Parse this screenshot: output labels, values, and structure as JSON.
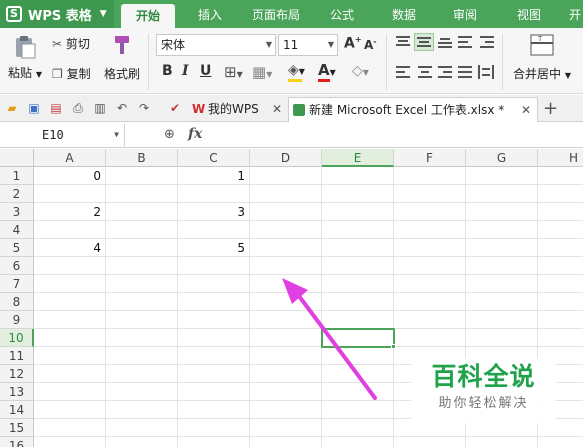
{
  "app": {
    "label": "WPS 表格",
    "logo": "S"
  },
  "menu": {
    "tabs": [
      {
        "label": "开始",
        "active": true
      },
      {
        "label": "插入"
      },
      {
        "label": "页面布局"
      },
      {
        "label": "公式"
      },
      {
        "label": "数据"
      },
      {
        "label": "审阅"
      },
      {
        "label": "视图"
      },
      {
        "label": "开"
      }
    ]
  },
  "ribbon": {
    "paste_label": "粘贴",
    "cut_label": "剪切",
    "copy_label": "复制",
    "format_painter_label": "格式刷",
    "font_name": "宋体",
    "font_size": "11",
    "bold": "B",
    "italic": "I",
    "underline": "U",
    "merge_label": "合并居中"
  },
  "tabs": {
    "my_wps": "我的WPS",
    "doc": "新建 Microsoft Excel 工作表.xlsx *",
    "add": "+"
  },
  "formula_bar": {
    "cell_ref": "E10",
    "fx": "fx"
  },
  "sheet": {
    "columns": [
      "A",
      "B",
      "C",
      "D",
      "E",
      "F",
      "G",
      "H"
    ],
    "rows": [
      "1",
      "2",
      "3",
      "4",
      "5",
      "6",
      "7",
      "8",
      "9",
      "10",
      "11",
      "12",
      "13",
      "14",
      "15",
      "16"
    ],
    "selected_column": "E",
    "selected_row": "10",
    "cells": [
      {
        "ref": "A1",
        "value": "0"
      },
      {
        "ref": "C1",
        "value": "1"
      },
      {
        "ref": "A3",
        "value": "2"
      },
      {
        "ref": "C3",
        "value": "3"
      },
      {
        "ref": "A5",
        "value": "4"
      },
      {
        "ref": "C5",
        "value": "5"
      }
    ]
  },
  "watermark": {
    "title": "百科全说",
    "subtitle": "助你轻松解决"
  },
  "colors": {
    "accent": "#4aa55a",
    "arrow": "#e040e0"
  }
}
